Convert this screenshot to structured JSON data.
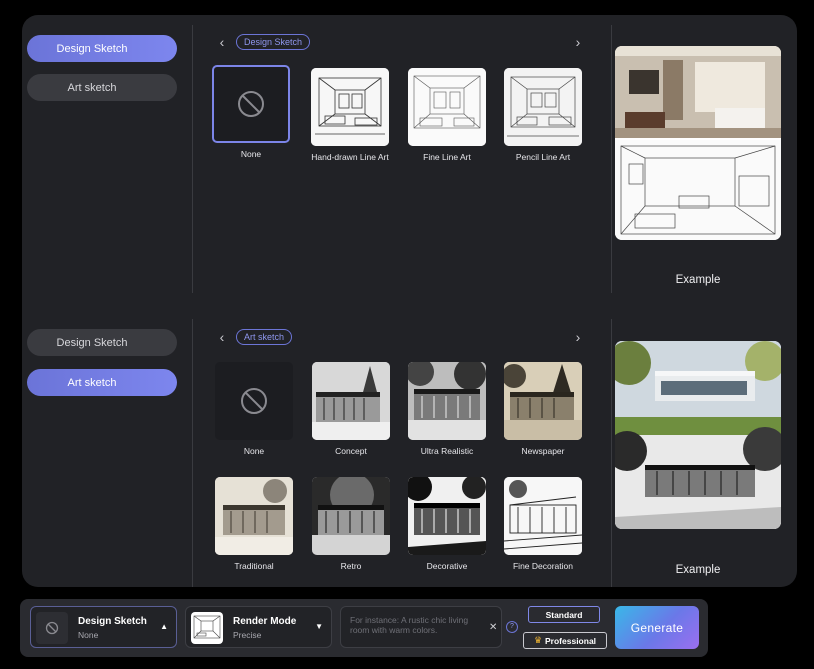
{
  "top": {
    "tabs": [
      {
        "label": "Design Sketch",
        "active": true
      },
      {
        "label": "Art sketch",
        "active": false
      }
    ],
    "tag": "Design Sketch",
    "styles": [
      "None",
      "Hand-drawn Line Art",
      "Fine Line Art",
      "Pencil Line Art"
    ],
    "selected": "None",
    "example_label": "Example"
  },
  "bottom": {
    "tabs": [
      {
        "label": "Design Sketch",
        "active": false
      },
      {
        "label": "Art sketch",
        "active": true
      }
    ],
    "tag": "Art sketch",
    "styles": [
      "None",
      "Concept",
      "Ultra Realistic",
      "Newspaper",
      "Traditional",
      "Retro",
      "Decorative",
      "Fine Decoration"
    ],
    "example_label": "Example"
  },
  "toolbar": {
    "style_select": {
      "title": "Design Sketch",
      "value": "None"
    },
    "render_select": {
      "title": "Render Mode",
      "value": "Precise"
    },
    "prompt_placeholder": "For instance: A rustic chic living room with warm colors.",
    "standard_label": "Standard",
    "professional_label": "Professional",
    "generate_label": "Generate"
  },
  "colors": {
    "accent": "#7580E6",
    "panel": "#212226",
    "background": "#000000"
  }
}
